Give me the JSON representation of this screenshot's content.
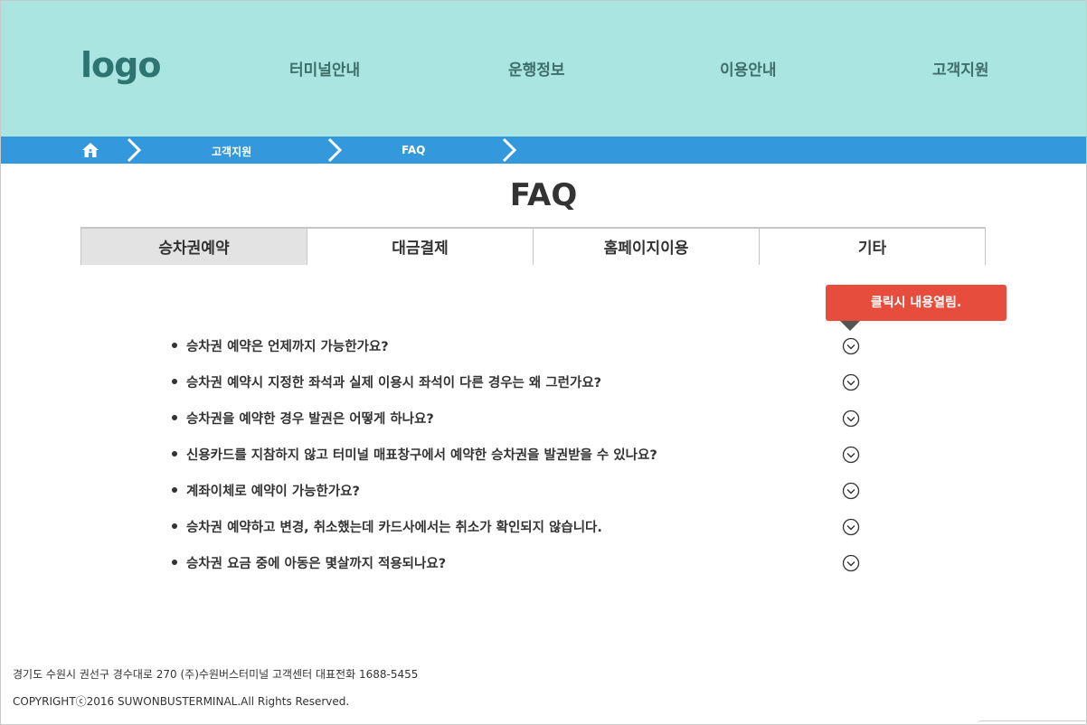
{
  "header": {
    "logo": "logo",
    "nav": [
      "터미널안내",
      "운행정보",
      "이용안내",
      "고객지원"
    ]
  },
  "breadcrumb": {
    "home_icon": "home-icon",
    "items": [
      "고객지원",
      "FAQ"
    ]
  },
  "main": {
    "title": "FAQ",
    "tabs": [
      "승차권예약",
      "대금결제",
      "홈페이지이용",
      "기타"
    ],
    "active_tab": "승차권예약",
    "tooltip": "클릭시 내용열림.",
    "questions": [
      "승차권 예약은 언제까지 가능한가요?",
      "승차권 예약시 지정한 좌석과 실제 이용시 좌석이 다른 경우는 왜 그런가요?",
      "승차권을 예약한 경우 발권은 어떻게 하나요?",
      "신용카드를 지참하지 않고 터미널 매표창구에서 예약한 승차권을 발권받을 수 있나요?",
      "계좌이체로 예약이 가능한가요?",
      "승차권 예약하고 변경, 취소했는데 카드사에서는 취소가 확인되지 않습니다.",
      "승차권 요금 중에 아동은 몇살까지 적용되나요?"
    ],
    "toggle_icon": "chevron-down-circle-icon"
  },
  "footer": {
    "address": "경기도 수원시 권선구 경수대로 270 (주)수원버스터미널  고객센터 대표전화  1688-5455",
    "copyright": "COPYRIGHTⓒ2016 SUWONBUSTERMINAL.All Rights Reserved."
  },
  "colors": {
    "header_bg": "#aae5e2",
    "breadcrumb_bg": "#3499dc",
    "tooltip_bg": "#e64d3d",
    "active_tab_bg": "#e3e3e3"
  }
}
